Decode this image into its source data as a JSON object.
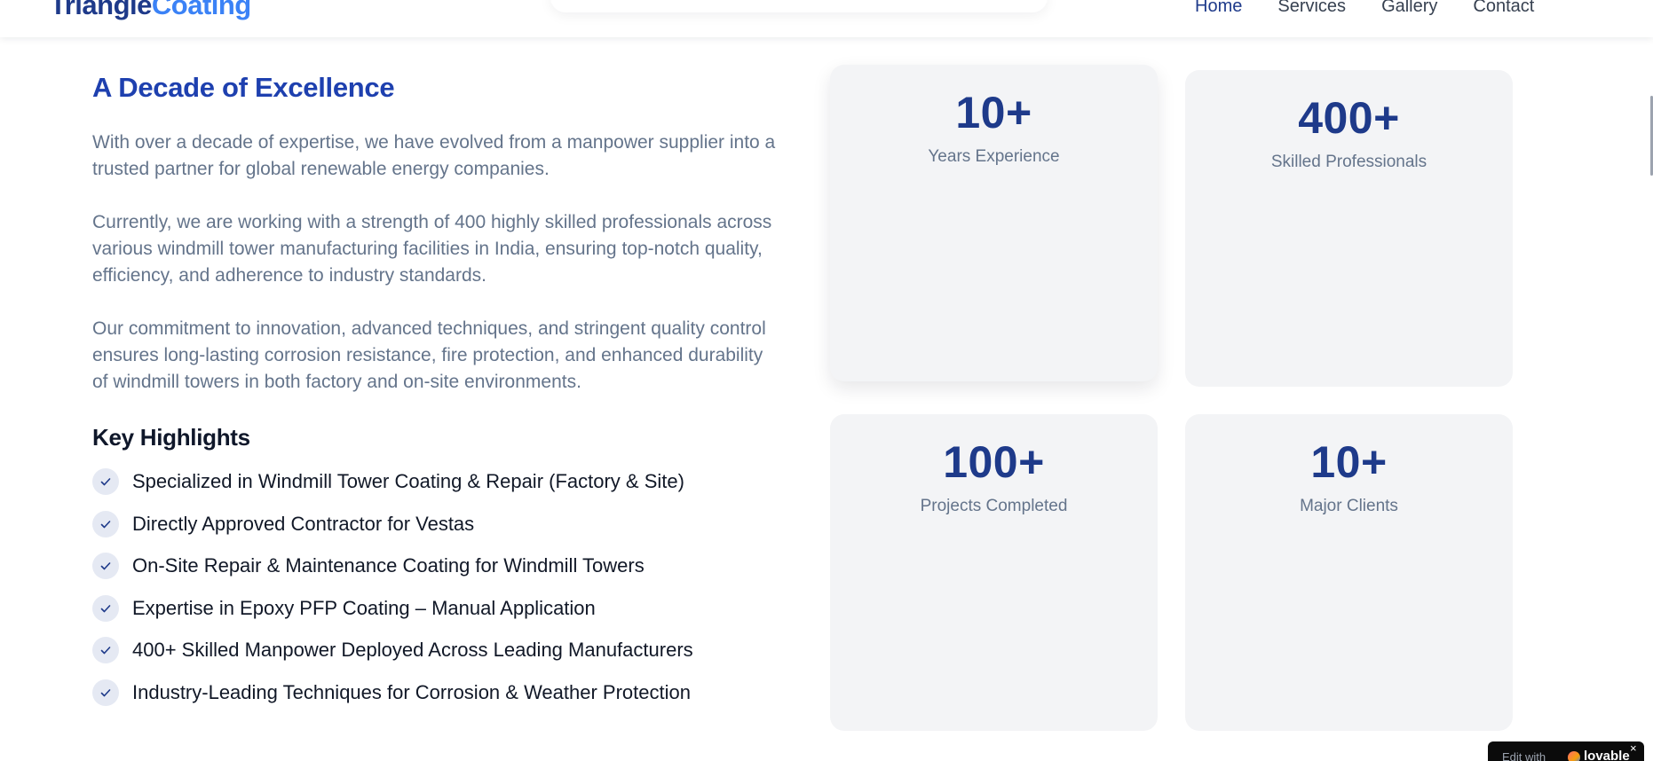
{
  "header": {
    "logo_part1": "Triangle",
    "logo_part2": "Coating",
    "nav": [
      "Home",
      "Services",
      "Gallery",
      "Contact"
    ],
    "active_nav": "Home"
  },
  "about": {
    "title": "A Decade of Excellence",
    "paragraphs": [
      "With over a decade of expertise, we have evolved from a manpower supplier into a trusted partner for global renewable energy companies.",
      "Currently, we are working with a strength of 400 highly skilled professionals across various windmill tower manufacturing facilities in India, ensuring top-notch quality, efficiency, and adherence to industry standards.",
      "Our commitment to innovation, advanced techniques, and stringent quality control ensures long-lasting corrosion resistance, fire protection, and enhanced durability of windmill towers in both factory and on-site environments."
    ],
    "highlights_title": "Key Highlights",
    "highlights": [
      "Specialized in Windmill Tower Coating & Repair (Factory & Site)",
      "Directly Approved Contractor for Vestas",
      "On-Site Repair & Maintenance Coating for Windmill Towers",
      "Expertise in Epoxy PFP Coating – Manual Application",
      "400+ Skilled Manpower Deployed Across Leading Manufacturers",
      "Industry-Leading Techniques for Corrosion & Weather Protection"
    ]
  },
  "stats": [
    {
      "value": "10+",
      "label": "Years Experience"
    },
    {
      "value": "400+",
      "label": "Skilled Professionals"
    },
    {
      "value": "100+",
      "label": "Projects Completed"
    },
    {
      "value": "10+",
      "label": "Major Clients"
    }
  ],
  "badge": {
    "edit_text": "Edit with",
    "brand": "lovable",
    "close": "×"
  },
  "colors": {
    "primary": "#1e3a8a",
    "accent": "#3b82f6",
    "muted_text": "#64748b",
    "card_bg": "#f3f4f6"
  }
}
